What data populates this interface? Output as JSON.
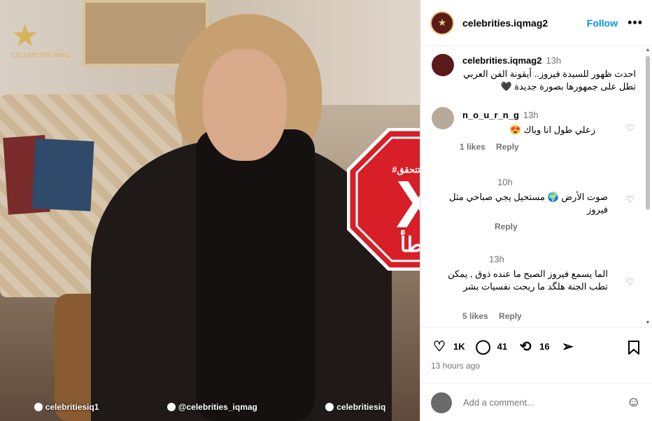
{
  "photo": {
    "watermark": "CELEBRITIES IRAQ",
    "socials": [
      "celebritiesiq1",
      "@celebrities_iqmag",
      "celebritiesiq"
    ]
  },
  "stamp": {
    "hashtag": "#النهار_تتحقق",
    "symbol": "X",
    "verdict": "خطأ",
    "color": "#d81e26"
  },
  "post": {
    "author": "celebrities.iqmag2",
    "follow_label": "Follow",
    "more_label": "•••",
    "caption": {
      "author": "celebrities.iqmag2",
      "time": "13h",
      "text": "احدث ظهور للسيدة فيروز.. أيقونة الفن العربي تطل على جمهورها بصورة جديدة 🖤"
    },
    "comments": [
      {
        "author": "n_o_u_r_n_g",
        "time": "13h",
        "text": "زعلي طول انا وياك 😍",
        "likes": "1 likes",
        "reply": "Reply"
      },
      {
        "author": "",
        "time": "10h",
        "text": "صوت الأرض 🌍 مستحيل يجي صباحي مثل فيروز",
        "likes": "",
        "reply": "Reply"
      },
      {
        "author": "",
        "time": "13h",
        "text": "الما يسمع فيروز الصبح ما عنده ذوق , يمكن تطب الجنة هلگد ما ريحت نفسيات بشر",
        "likes": "5 likes",
        "reply": "Reply"
      }
    ],
    "stats": {
      "likes": "1K",
      "comments": "41",
      "reposts": "16"
    },
    "ago": "13 hours ago",
    "add_comment_placeholder": "Add a comment..."
  }
}
